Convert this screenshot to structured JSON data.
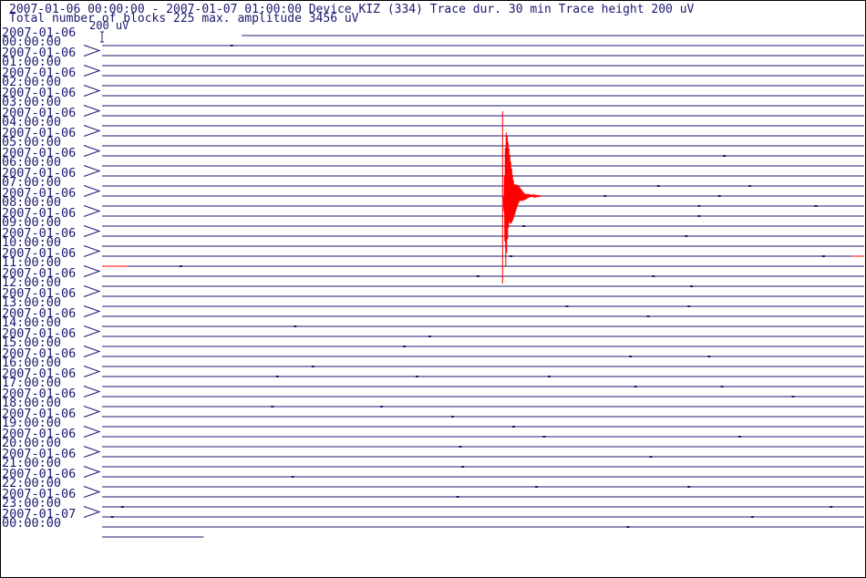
{
  "header": {
    "line1": "2007-01-06 00:00:00 - 2007-01-07 01:00:00  Device  KIZ (334)  Trace dur. 30 min  Trace height 200 uV",
    "line2": "Total number of blocks 225 max. amplitude 3456 uV"
  },
  "scale": {
    "label": "200 uV"
  },
  "colors": {
    "trace": "#191970",
    "event": "#ff0000",
    "frame": "#000000",
    "background": "#ffffff"
  },
  "chart_data": {
    "type": "seismogram",
    "title": "",
    "start": "2007-01-06 00:00:00",
    "end": "2007-01-07 01:00:00",
    "device": "KIZ (334)",
    "trace_duration_min": 30,
    "trace_height_uV": 200,
    "total_blocks": 225,
    "max_amplitude_uV": 3456,
    "row_count": 51,
    "hour_labels": [
      {
        "date": "2007-01-06",
        "time": "00:00:00"
      },
      {
        "date": "2007-01-06",
        "time": "01:00:00"
      },
      {
        "date": "2007-01-06",
        "time": "02:00:00"
      },
      {
        "date": "2007-01-06",
        "time": "03:00:00"
      },
      {
        "date": "2007-01-06",
        "time": "04:00:00"
      },
      {
        "date": "2007-01-06",
        "time": "05:00:00"
      },
      {
        "date": "2007-01-06",
        "time": "06:00:00"
      },
      {
        "date": "2007-01-06",
        "time": "07:00:00"
      },
      {
        "date": "2007-01-06",
        "time": "08:00:00"
      },
      {
        "date": "2007-01-06",
        "time": "09:00:00"
      },
      {
        "date": "2007-01-06",
        "time": "10:00:00"
      },
      {
        "date": "2007-01-06",
        "time": "11:00:00"
      },
      {
        "date": "2007-01-06",
        "time": "12:00:00"
      },
      {
        "date": "2007-01-06",
        "time": "13:00:00"
      },
      {
        "date": "2007-01-06",
        "time": "14:00:00"
      },
      {
        "date": "2007-01-06",
        "time": "15:00:00"
      },
      {
        "date": "2007-01-06",
        "time": "16:00:00"
      },
      {
        "date": "2007-01-06",
        "time": "17:00:00"
      },
      {
        "date": "2007-01-06",
        "time": "18:00:00"
      },
      {
        "date": "2007-01-06",
        "time": "19:00:00"
      },
      {
        "date": "2007-01-06",
        "time": "20:00:00"
      },
      {
        "date": "2007-01-06",
        "time": "21:00:00"
      },
      {
        "date": "2007-01-06",
        "time": "22:00:00"
      },
      {
        "date": "2007-01-06",
        "time": "23:00:00"
      },
      {
        "date": "2007-01-07",
        "time": "00:00:00"
      }
    ],
    "first_trace_start_min": 5.5,
    "last_trace_end_min": 4,
    "ticks": [
      [
        1,
        5.1
      ],
      [
        12,
        24.5
      ],
      [
        15,
        25.5
      ],
      [
        15,
        21.9
      ],
      [
        16,
        24.3
      ],
      [
        16,
        19.8
      ],
      [
        17,
        23.5
      ],
      [
        17,
        28.1
      ],
      [
        18,
        23.5
      ],
      [
        19,
        16.6
      ],
      [
        20,
        23.0
      ],
      [
        22,
        16.1
      ],
      [
        22,
        28.4
      ],
      [
        23,
        3.1
      ],
      [
        24,
        14.8
      ],
      [
        24,
        21.7
      ],
      [
        25,
        23.2
      ],
      [
        27,
        18.3
      ],
      [
        27,
        23.1
      ],
      [
        28,
        21.5
      ],
      [
        29,
        7.6
      ],
      [
        30,
        12.9
      ],
      [
        31,
        11.9
      ],
      [
        32,
        20.8
      ],
      [
        32,
        23.9
      ],
      [
        33,
        8.3
      ],
      [
        34,
        6.9
      ],
      [
        34,
        12.4
      ],
      [
        34,
        17.6
      ],
      [
        35,
        24.4
      ],
      [
        35,
        21.0
      ],
      [
        36,
        27.2
      ],
      [
        37,
        6.7
      ],
      [
        37,
        11.0
      ],
      [
        38,
        13.8
      ],
      [
        39,
        16.2
      ],
      [
        40,
        17.4
      ],
      [
        40,
        25.1
      ],
      [
        41,
        14.1
      ],
      [
        42,
        21.6
      ],
      [
        43,
        14.2
      ],
      [
        44,
        7.5
      ],
      [
        45,
        17.1
      ],
      [
        45,
        23.1
      ],
      [
        46,
        14.0
      ],
      [
        47,
        0.8
      ],
      [
        47,
        28.7
      ],
      [
        48,
        0.4
      ],
      [
        48,
        25.6
      ],
      [
        49,
        20.7
      ]
    ],
    "event": {
      "row": 16,
      "onset_min": 15.8,
      "duration_min": 1.5,
      "peak_uV": 3456
    }
  }
}
